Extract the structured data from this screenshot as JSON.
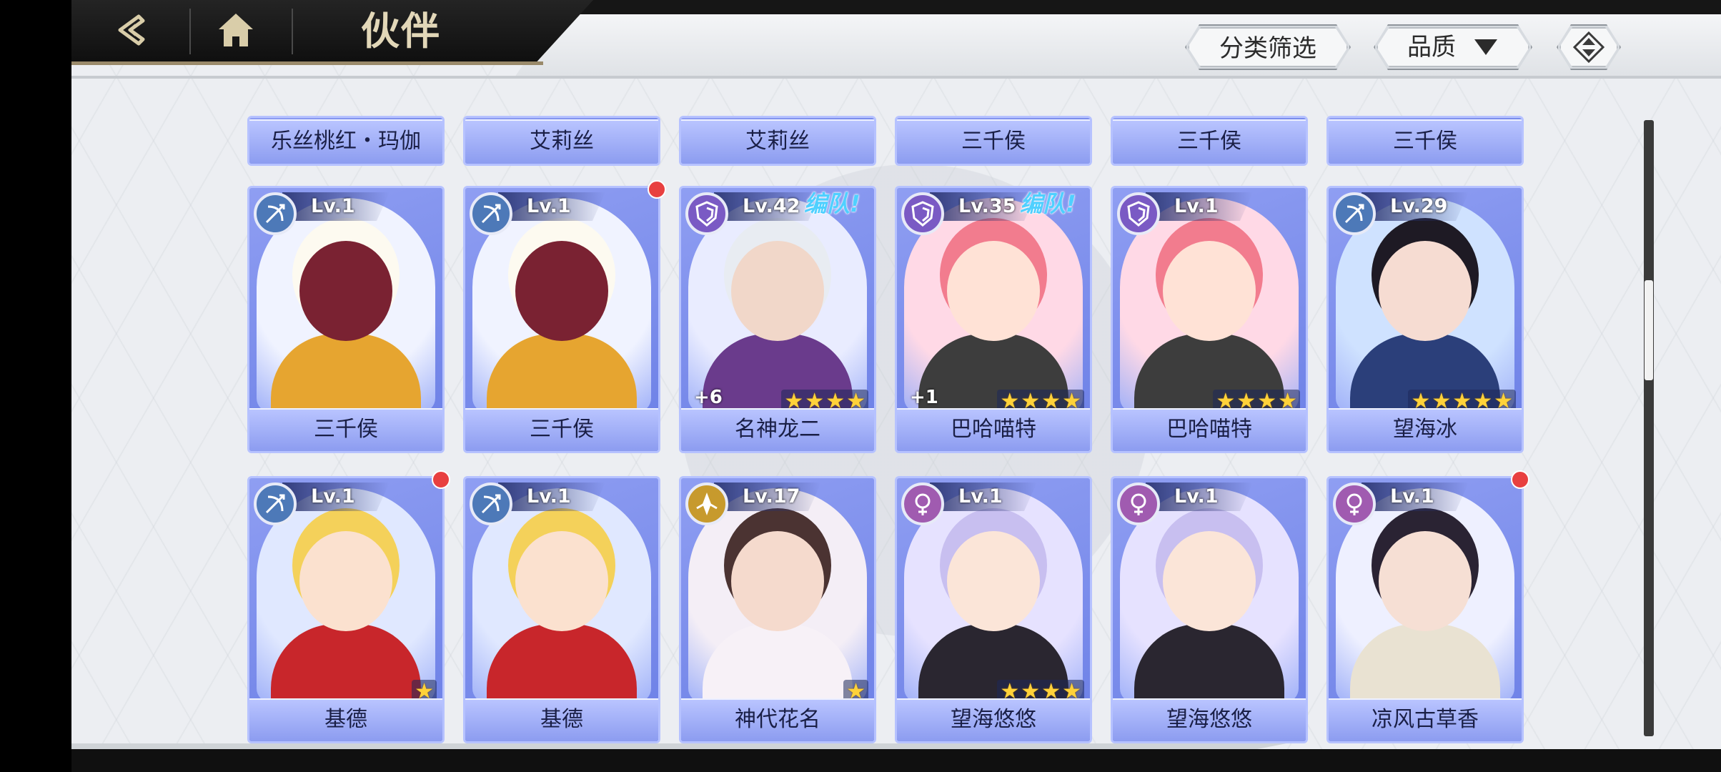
{
  "header": {
    "title": "伙伴",
    "filter_label": "分类筛选",
    "quality_label": "品质"
  },
  "icons": {
    "back": "back-arrow-icon",
    "home": "home-icon",
    "sort": "sort-toggle-icon",
    "dropdown": "triangle-down-icon"
  },
  "colors": {
    "card_blue": "#7c8ff0",
    "team_tag": "#4fd0ff",
    "star": "#ffd23a",
    "red_dot": "#e84040"
  },
  "row_partial": [
    {
      "name": "乐丝桃红・玛伽",
      "stars_visible": true
    },
    {
      "name": "艾莉丝",
      "stars_visible": false
    },
    {
      "name": "艾莉丝",
      "stars_visible": true
    },
    {
      "name": "三千侯",
      "stars_visible": false
    },
    {
      "name": "三千侯",
      "stars_visible": false
    },
    {
      "name": "三千侯",
      "stars_visible": false
    }
  ],
  "cards": [
    {
      "name": "三千侯",
      "level": "Lv.1",
      "role": "archer",
      "team": "",
      "plus": "",
      "stars": 0,
      "red_dot": false,
      "palette": "beast"
    },
    {
      "name": "三千侯",
      "level": "Lv.1",
      "role": "archer",
      "team": "",
      "plus": "",
      "stars": 0,
      "red_dot": true,
      "palette": "beast"
    },
    {
      "name": "名神龙二",
      "level": "Lv.42",
      "role": "tank",
      "team": "编队!",
      "plus": "+6",
      "stars": 4,
      "red_dot": false,
      "palette": "silver"
    },
    {
      "name": "巴哈喵特",
      "level": "Lv.35",
      "role": "tank",
      "team": "编队!",
      "plus": "+1",
      "stars": 4,
      "red_dot": false,
      "palette": "pink"
    },
    {
      "name": "巴哈喵特",
      "level": "Lv.1",
      "role": "tank",
      "team": "",
      "plus": "",
      "stars": 4,
      "red_dot": false,
      "palette": "pink"
    },
    {
      "name": "望海冰",
      "level": "Lv.29",
      "role": "archer",
      "team": "",
      "plus": "",
      "stars": 5,
      "red_dot": false,
      "palette": "dark"
    },
    {
      "name": "基德",
      "level": "Lv.1",
      "role": "archer",
      "team": "",
      "plus": "",
      "stars": 1,
      "red_dot": true,
      "palette": "blond"
    },
    {
      "name": "基德",
      "level": "Lv.1",
      "role": "archer",
      "team": "",
      "plus": "",
      "stars": 0,
      "red_dot": false,
      "palette": "blond"
    },
    {
      "name": "神代花名",
      "level": "Lv.17",
      "role": "healer",
      "team": "",
      "plus": "",
      "stars": 1,
      "red_dot": false,
      "palette": "rose"
    },
    {
      "name": "望海悠悠",
      "level": "Lv.1",
      "role": "support",
      "team": "",
      "plus": "",
      "stars": 4,
      "red_dot": false,
      "palette": "lavender"
    },
    {
      "name": "望海悠悠",
      "level": "Lv.1",
      "role": "support",
      "team": "",
      "plus": "",
      "stars": 0,
      "red_dot": false,
      "palette": "lavender"
    },
    {
      "name": "凉风古草香",
      "level": "Lv.1",
      "role": "support",
      "team": "",
      "plus": "",
      "stars": 0,
      "red_dot": true,
      "palette": "scholar"
    }
  ],
  "scroll": {
    "position_fraction": 0.31
  }
}
